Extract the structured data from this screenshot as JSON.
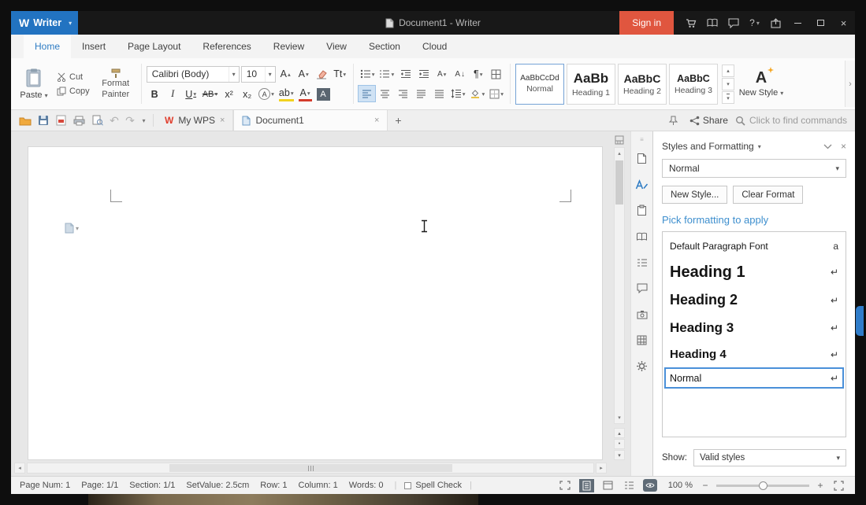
{
  "colors": {
    "accent_blue": "#2e7cc4",
    "signin_orange": "#e0563f",
    "link_blue": "#3e8fce",
    "titlebar": "#181818"
  },
  "icons": {
    "caret": "▾",
    "caret_up": "▴",
    "caret_left": "◂",
    "caret_right": "▸",
    "close": "×",
    "plus": "+",
    "minus": "−",
    "return": "↵",
    "char_a": "a",
    "pilcrow": "¶",
    "undo": "↶",
    "redo": "↷",
    "more": "›",
    "help": "?",
    "grip": "≡",
    "dot": "•",
    "A": "A",
    "arrow_down": "↓"
  },
  "titlebar": {
    "logo": "W",
    "app_name": "Writer",
    "title": "Document1 - Writer",
    "signin": "Sign in"
  },
  "menu": {
    "tabs": [
      "Home",
      "Insert",
      "Page Layout",
      "References",
      "Review",
      "View",
      "Section",
      "Cloud"
    ]
  },
  "ribbon": {
    "paste": "Paste",
    "cut": "Cut",
    "copy": "Copy",
    "format_painter_line1": "Format",
    "format_painter_line2": "Painter",
    "font_name": "Calibri (Body)",
    "font_size": "10",
    "bold": "B",
    "italic": "I",
    "underline": "U",
    "strikethrough": "AB",
    "superscript": "x²",
    "subscript": "x₂",
    "change_case": "Tt",
    "highlight": "ab",
    "gallery": [
      {
        "preview": "AaBbCcDd",
        "name": "Normal"
      },
      {
        "preview": "AaBb",
        "name": "Heading 1"
      },
      {
        "preview": "AaBbC",
        "name": "Heading 2"
      },
      {
        "preview": "AaBbC",
        "name": "Heading 3"
      }
    ],
    "new_style": "New Style"
  },
  "quickbar": {
    "wps_logo": "W",
    "tab_mywps": "My WPS",
    "tab_document": "Document1",
    "share": "Share",
    "find_hint": "Click to find commands"
  },
  "panel": {
    "title": "Styles and Formatting",
    "style_selector": "Normal",
    "new_style_button": "New Style...",
    "clear_format_button": "Clear Format",
    "pick_formatting": "Pick formatting to apply",
    "items": [
      {
        "label": "Default Paragraph Font"
      },
      {
        "label": "Heading 1"
      },
      {
        "label": "Heading 2"
      },
      {
        "label": "Heading 3"
      },
      {
        "label": "Heading 4"
      },
      {
        "label": "Normal"
      }
    ],
    "show_label": "Show:",
    "show_value": "Valid styles"
  },
  "statusbar": {
    "page_num": "Page Num: 1",
    "page": "Page: 1/1",
    "section": "Section: 1/1",
    "set_value": "SetValue: 2.5cm",
    "row": "Row: 1",
    "column": "Column: 1",
    "words": "Words: 0",
    "spell_check": "Spell Check",
    "zoom": "100 %"
  }
}
